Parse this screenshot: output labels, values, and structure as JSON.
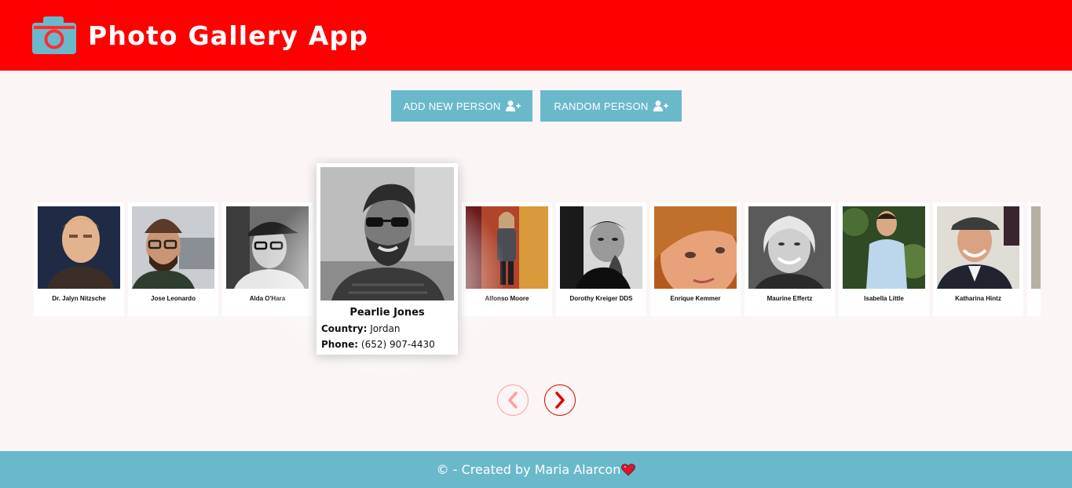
{
  "header": {
    "title": "Photo Gallery App",
    "icon": "camera-icon"
  },
  "actions": {
    "add_label": "ADD NEW PERSON",
    "random_label": "RANDOM PERSON",
    "icon": "user-plus-icon"
  },
  "gallery": {
    "people": [
      {
        "name": "Dr. Jalyn Nitzsche"
      },
      {
        "name": "Jose Leonardo"
      },
      {
        "name": "Alda O'Hara"
      },
      {
        "name": "Alfonso Moore"
      },
      {
        "name": "Dorothy Kreiger DDS"
      },
      {
        "name": "Enrique Kemmer"
      },
      {
        "name": "Maurine Effertz"
      },
      {
        "name": "Isabella Little"
      },
      {
        "name": "Katharina Hintz"
      }
    ],
    "featured": {
      "name": "Pearlie Jones",
      "country_label": "Country:",
      "country": "Jordan",
      "phone_label": "Phone:",
      "phone": "(652) 907-4430"
    }
  },
  "nav": {
    "prev_icon": "chevron-left-icon",
    "next_icon": "chevron-right-icon"
  },
  "footer": {
    "text": "© - Created by Maria Alarcon",
    "icon": "heart-icon"
  },
  "colors": {
    "header_bg": "#ff0000",
    "accent": "#6ab9cb",
    "page_bg": "#fbf5f5"
  }
}
